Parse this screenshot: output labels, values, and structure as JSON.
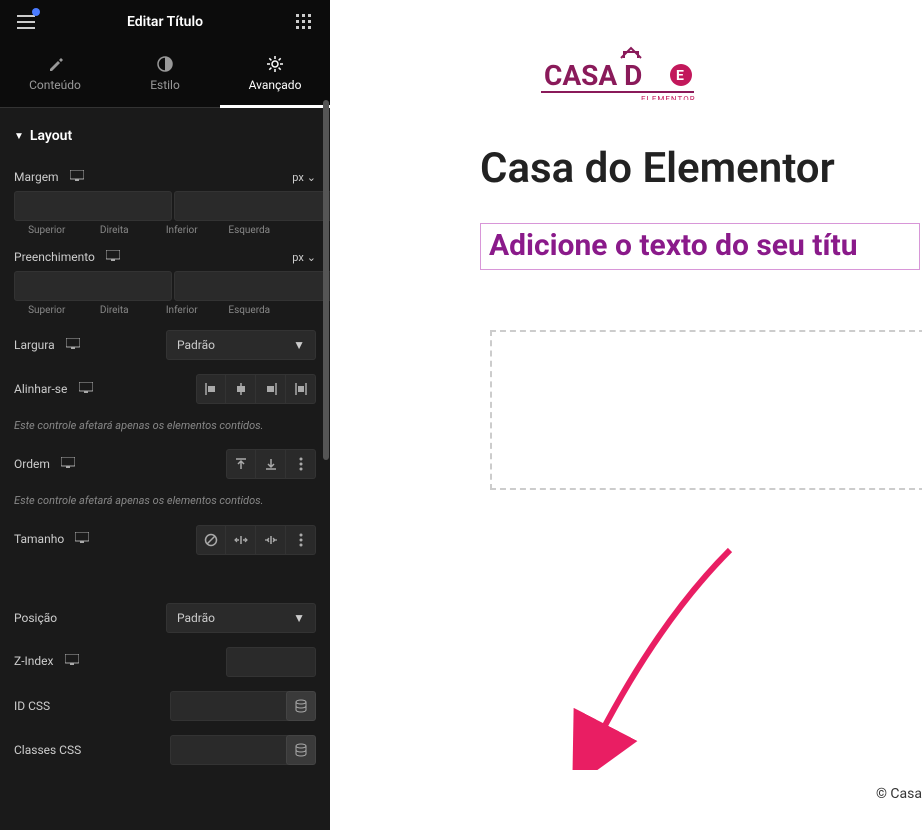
{
  "header": {
    "title": "Editar Título"
  },
  "tabs": {
    "content": "Conteúdo",
    "style": "Estilo",
    "advanced": "Avançado"
  },
  "layout": {
    "section_title": "Layout",
    "margin": {
      "label": "Margem",
      "unit": "px",
      "top": "Superior",
      "right": "Direita",
      "bottom": "Inferior",
      "left": "Esquerda"
    },
    "padding": {
      "label": "Preenchimento",
      "unit": "px",
      "top": "Superior",
      "right": "Direita",
      "bottom": "Inferior",
      "left": "Esquerda"
    },
    "width": {
      "label": "Largura",
      "value": "Padrão"
    },
    "align": {
      "label": "Alinhar-se",
      "help": "Este controle afetará apenas os elementos contidos."
    },
    "order": {
      "label": "Ordem",
      "help": "Este controle afetará apenas os elementos contidos."
    },
    "size": {
      "label": "Tamanho"
    },
    "position": {
      "label": "Posição",
      "value": "Padrão"
    },
    "zindex": {
      "label": "Z-Index"
    },
    "css_id": {
      "label": "ID CSS"
    },
    "css_classes": {
      "label": "Classes CSS"
    }
  },
  "canvas": {
    "logo_main": "CASA D",
    "logo_sub": "ELEMENTOR",
    "page_title": "Casa do Elementor",
    "heading": "Adicione o texto do seu títu",
    "footer": "© Casa"
  }
}
